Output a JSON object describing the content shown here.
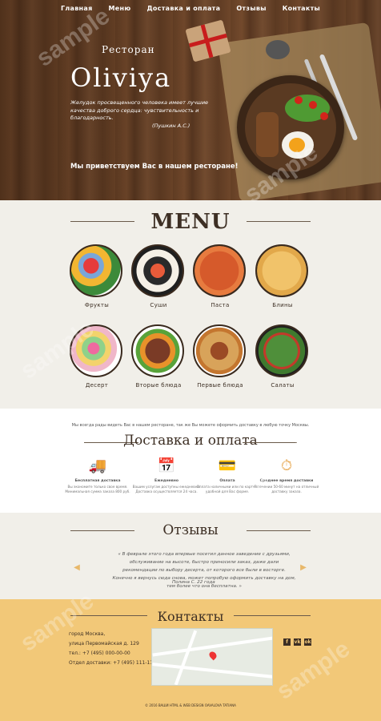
{
  "nav": [
    "Главная",
    "Меню",
    "Доставка и оплата",
    "Отзывы",
    "Контакты"
  ],
  "hero": {
    "subtitle": "Ресторан",
    "title": "Oliviya",
    "quote": "Желудок просвещенного человека имеет лучшие качества доброго сердца: чувствительность и благодарность.",
    "author": "(Пушкин А.С.)",
    "welcome": "Мы приветствуем Вас в нашем ресторане!"
  },
  "menu": {
    "title": "MENU",
    "items": [
      {
        "label": "Фрукты",
        "icon": "fruits-dish"
      },
      {
        "label": "Суши",
        "icon": "sushi-dish"
      },
      {
        "label": "Паста",
        "icon": "pasta-dish"
      },
      {
        "label": "Блины",
        "icon": "pancakes-dish"
      },
      {
        "label": "Десерт",
        "icon": "dessert-dish"
      },
      {
        "label": "Вторые блюда",
        "icon": "main-course-dish"
      },
      {
        "label": "Первые блюда",
        "icon": "soup-dish"
      },
      {
        "label": "Салаты",
        "icon": "salad-dish"
      }
    ]
  },
  "delivery": {
    "intro": "Мы всегда рады видеть Вас в нашем ресторане, так же Вы можете оформить доставку в любую точку Москвы.",
    "title": "Доставка и оплата",
    "features": [
      {
        "title": "Бесплатная доставка",
        "text": "Вы экономите только свое время. Минимальная сумма заказа 800 руб.",
        "icon": "truck-icon"
      },
      {
        "title": "Ежедневно",
        "text": "Вашим услугам доступны ежедневно. Доставка осуществляется 24 часа.",
        "icon": "calendar-icon"
      },
      {
        "title": "Оплата",
        "text": "Оплата наличными или по карте в удобной для Вас форме.",
        "icon": "card-icon"
      },
      {
        "title": "Среднее время доставки",
        "text": "В течении 50-60 минут на отличный доставку заказа.",
        "icon": "clock-icon"
      }
    ]
  },
  "reviews": {
    "title": "Отзывы",
    "text": "« В феврале этого года впервые посетил данное заведение с друзьями, обслуживание на высоте, быстро приносили заказ, даже дали рекомендации по выбору десерта, от которого все были в восторге. Конечно я вернусь сюда снова, может попробую оформить доставку на дом, тем более что она бесплатна. »",
    "author": "Полина С. 22 года"
  },
  "contacts": {
    "title": "Контакты",
    "lines": [
      "город Москва,",
      "улица Первомайская д. 129",
      "тел.: +7 (495) 000-00-00",
      "Отдел доставки: +7 (495) 111-11-11"
    ],
    "social": [
      "f",
      "vk",
      "ok"
    ],
    "copyright": "© 2016 ВАШИ HTML & WEB DESIGN OAVALOVA TATIANA"
  },
  "colors": {
    "cream": "#f1efe9",
    "sand": "#f2c878",
    "brown": "#3d2f24",
    "accent": "#e7a64d"
  }
}
